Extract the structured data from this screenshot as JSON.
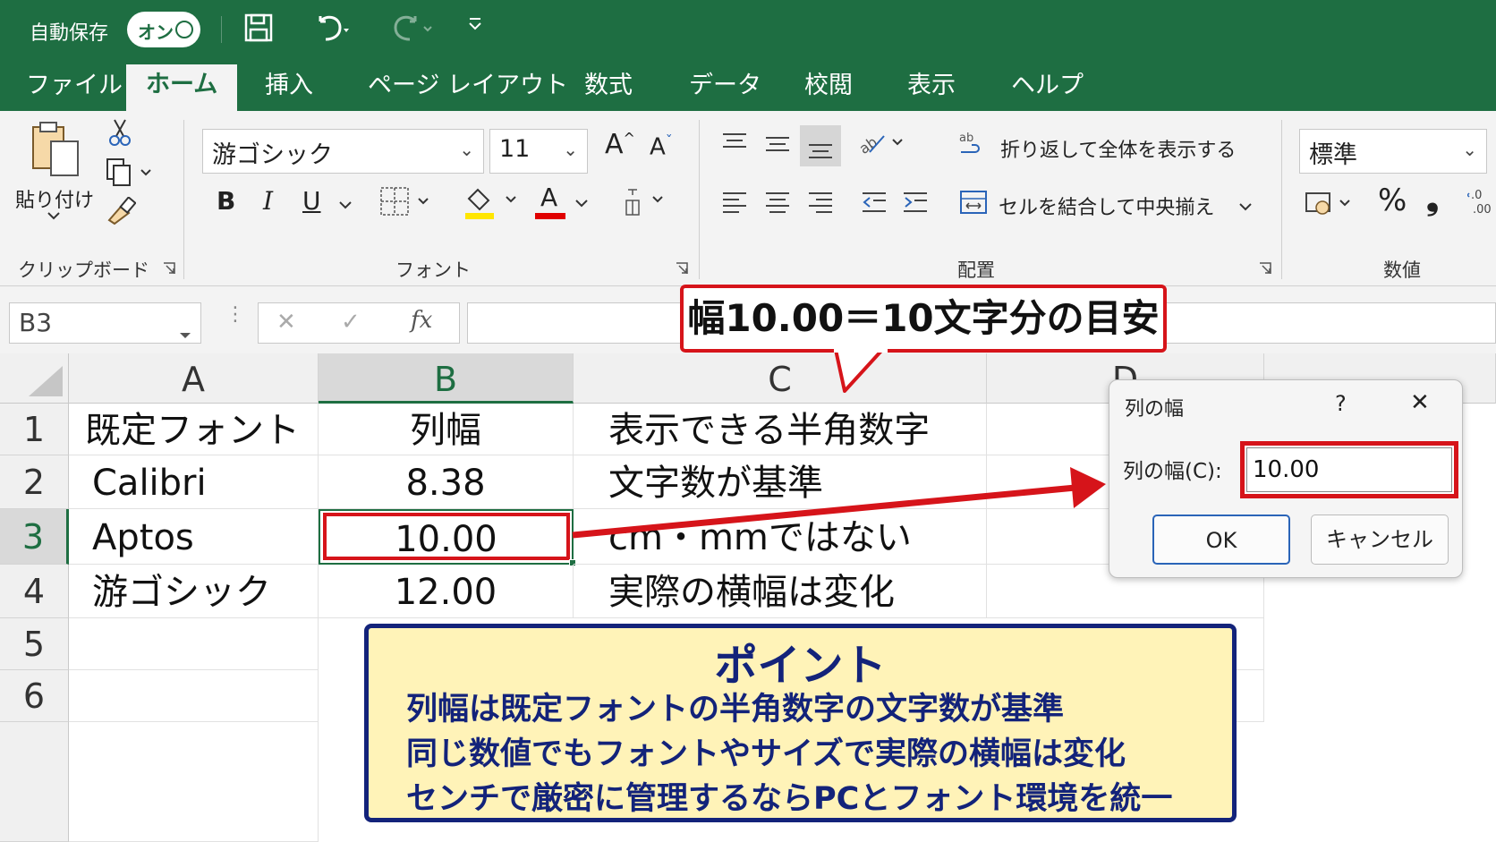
{
  "titlebar": {
    "autosave_label": "自動保存",
    "toggle_label": "オン",
    "qat_more": "⌄"
  },
  "tabs": [
    {
      "label": "ファイル"
    },
    {
      "label": "ホーム",
      "active": true
    },
    {
      "label": "挿入"
    },
    {
      "label": "ページ レイアウト"
    },
    {
      "label": "数式"
    },
    {
      "label": "データ"
    },
    {
      "label": "校閲"
    },
    {
      "label": "表示"
    },
    {
      "label": "ヘルプ"
    }
  ],
  "ribbon": {
    "clipboard": {
      "paste_label": "貼り付け",
      "group_label": "クリップボード"
    },
    "font": {
      "font_name": "游ゴシック",
      "font_size": "11",
      "bold": "B",
      "italic": "I",
      "underline": "U",
      "font_color_glyph": "A",
      "grow_font": "A",
      "shrink_font": "A",
      "group_label": "フォント"
    },
    "alignment": {
      "wrap_text": "折り返して全体を表示する",
      "merge_center": "セルを結合して中央揃え",
      "group_label": "配置"
    },
    "number": {
      "format": "標準",
      "percent": "%",
      "comma": "❟",
      "group_label": "数値"
    }
  },
  "formula_bar": {
    "name_box": "B3",
    "cancel": "✕",
    "enter": "✓",
    "fx": "fx",
    "formula": ""
  },
  "sheet": {
    "columns": [
      "A",
      "B",
      "C",
      "D"
    ],
    "rows": [
      "1",
      "2",
      "3",
      "4",
      "5",
      "6"
    ],
    "cells": {
      "A1": "既定フォント",
      "B1": "列幅",
      "C1": "表示できる半角数字",
      "A2": "Calibri",
      "B2": "8.38",
      "C2": "文字数が基準",
      "A3": "Aptos",
      "B3": "10.00",
      "C3": "cm・mmではない",
      "A4": "游ゴシック",
      "B4": "12.00",
      "C4": "実際の横幅は変化"
    }
  },
  "callout": {
    "text": "幅10.00＝10文字分の目安"
  },
  "dialog": {
    "title": "列の幅",
    "help": "?",
    "close": "✕",
    "field_label": "列の幅(C):",
    "field_value": "10.00",
    "ok_label": "OK",
    "cancel_label": "キャンセル"
  },
  "point_box": {
    "title": "ポイント",
    "lines": [
      "列幅は既定フォントの半角数字の文字数が基準",
      "同じ数値でもフォントやサイズで実際の横幅は変化",
      "センチで厳密に管理するならPCとフォント環境を統一"
    ]
  },
  "colors": {
    "excel_green": "#1e6e42",
    "highlight_red": "#d6141a",
    "point_navy": "#13237a",
    "point_bg": "#fff3b8"
  }
}
